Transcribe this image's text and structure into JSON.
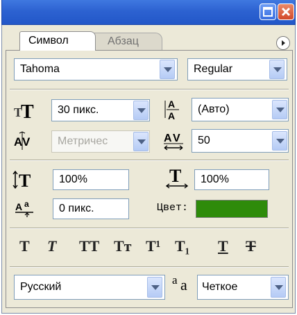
{
  "window": {
    "minimize_icon": "minimize-icon",
    "close_icon": "close-icon"
  },
  "tabs": [
    {
      "label": "Символ",
      "active": true
    },
    {
      "label": "Абзац",
      "active": false
    }
  ],
  "panel_menu_icon": "panel-menu-icon",
  "font": {
    "family": "Tahoma",
    "style": "Regular"
  },
  "size": {
    "font_size": "30 пикс.",
    "leading": "(Авто)",
    "kerning": "Метричес",
    "tracking": "50"
  },
  "scale": {
    "vertical": "100%",
    "horizontal": "100%",
    "baseline_shift": "0 пикс.",
    "color_label": "Цвет:",
    "color_value": "#2e8b0a"
  },
  "style_buttons": [
    {
      "name": "faux-bold",
      "glyph": "T"
    },
    {
      "name": "faux-italic",
      "glyph": "T"
    },
    {
      "name": "all-caps",
      "glyph": "TT"
    },
    {
      "name": "small-caps",
      "glyph": "Tт"
    },
    {
      "name": "superscript",
      "glyph": "T¹"
    },
    {
      "name": "subscript",
      "glyph": "T₁"
    },
    {
      "name": "underline",
      "glyph": "T"
    },
    {
      "name": "strikethrough",
      "glyph": "T"
    }
  ],
  "language": {
    "value": "Русский",
    "antialias_icon": "aa-icon",
    "antialias_label": "a",
    "antialias_label_small": "a",
    "antialias_value": "Четкое"
  },
  "colors": {
    "titlebar": "#2d62d1",
    "panel_bg": "#ece9d8",
    "field_border": "#7f9db9"
  }
}
